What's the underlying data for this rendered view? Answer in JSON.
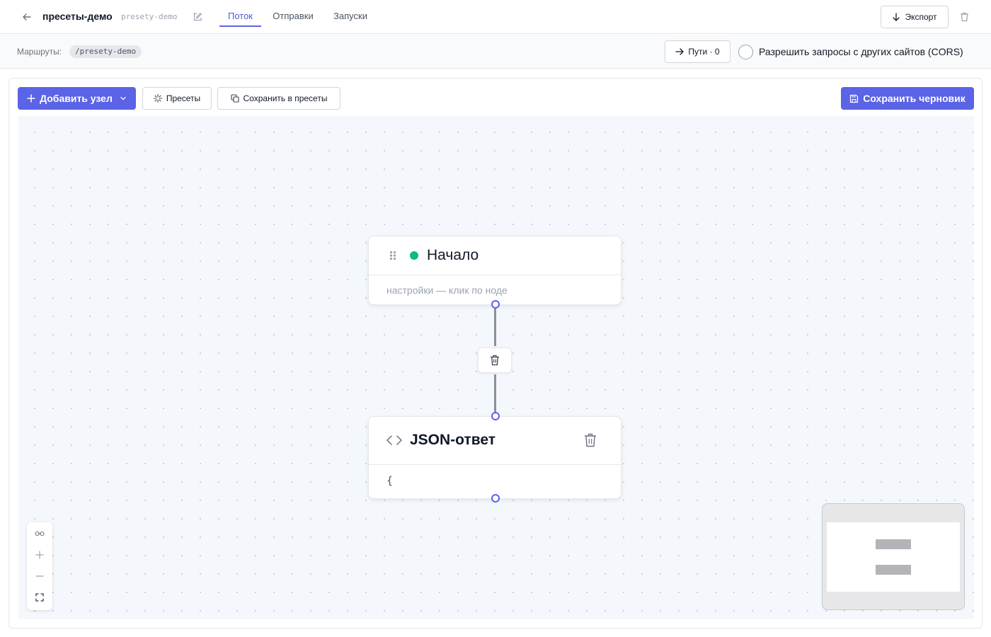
{
  "header": {
    "title": "пресеты-демо",
    "slug": "presety-demo",
    "tabs": [
      {
        "label": "Поток",
        "active": true
      },
      {
        "label": "Отправки",
        "active": false
      },
      {
        "label": "Запуски",
        "active": false
      }
    ],
    "export_label": "Экспорт"
  },
  "routes": {
    "label": "Маршруты:",
    "chip": "/presety-demo",
    "paths_label": "Пути · 0",
    "cors_label": "Разрешить запросы с других сайтов (CORS)",
    "cors_checked": false
  },
  "toolbar": {
    "add_node_label": "Добавить узел",
    "presets_label": "Пресеты",
    "save_to_presets_label": "Сохранить в пресеты",
    "save_draft_label": "Сохранить черновик"
  },
  "nodes": {
    "start": {
      "title": "Начало",
      "subtitle": "настройки — клик по ноде",
      "status_color": "#10b981"
    },
    "json": {
      "title": "JSON-ответ",
      "body": "{"
    }
  },
  "colors": {
    "accent": "#5b63e6",
    "edge": "#8b8f98",
    "status": "#10b981"
  },
  "icons": {
    "back": "arrow-left-icon",
    "edit": "pencil-icon",
    "export": "arrow-down-icon",
    "delete": "trash-icon",
    "paths": "arrow-right-icon",
    "add": "plus-icon",
    "chevron": "chevron-down-icon",
    "presets": "sparkle-icon",
    "copy": "copy-icon",
    "save": "floppy-icon",
    "drag": "drag-handle-icon",
    "code": "code-icon",
    "link": "link-icon",
    "zoom_in": "plus-icon",
    "zoom_out": "minus-icon",
    "fit": "fit-view-icon"
  }
}
